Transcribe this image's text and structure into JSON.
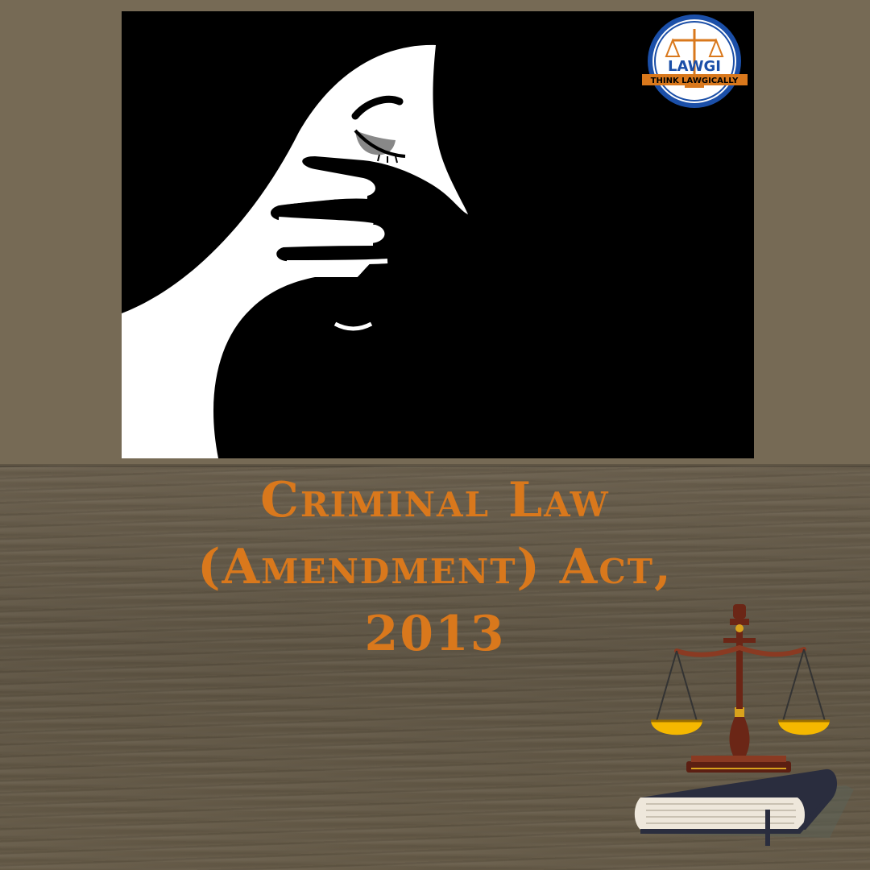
{
  "logo": {
    "brand_text": "LAWGI",
    "tagline": "THINK LAWGICALLY",
    "icon": "scales-of-justice-icon",
    "colors": {
      "ring": "#1b4fa8",
      "ribbon": "#d9781c"
    }
  },
  "hero": {
    "icon": "silenced-woman-illustration"
  },
  "title": {
    "line1": "Criminal Law",
    "line2": "(Amendment) Act,",
    "line3": "2013"
  },
  "decor": {
    "icon": "scales-on-book-icon"
  },
  "colors": {
    "title": "#d9781c",
    "background": "#766a55"
  }
}
